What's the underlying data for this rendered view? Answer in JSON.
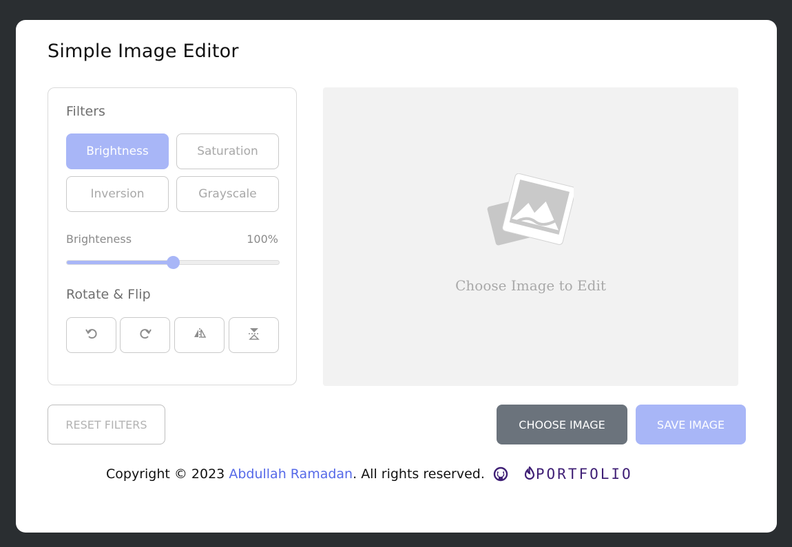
{
  "app": {
    "title": "Simple Image Editor"
  },
  "filters": {
    "heading": "Filters",
    "buttons": [
      {
        "label": "Brightness",
        "active": true
      },
      {
        "label": "Saturation",
        "active": false
      },
      {
        "label": "Inversion",
        "active": false
      },
      {
        "label": "Grayscale",
        "active": false
      }
    ]
  },
  "slider": {
    "label": "Brighteness",
    "value_text": "100%",
    "fill_fraction": 0.5
  },
  "rotate": {
    "heading": "Rotate & Flip",
    "buttons": [
      "rotate-left-icon",
      "rotate-right-icon",
      "flip-horizontal-icon",
      "flip-vertical-icon"
    ]
  },
  "preview": {
    "placeholder_text": "Choose Image to Edit",
    "icon": "image-placeholder-icon"
  },
  "actions": {
    "reset_label": "RESET FILTERS",
    "choose_label": "CHOOSE IMAGE",
    "save_label": "SAVE IMAGE"
  },
  "footer": {
    "prefix": "Copyright © 2023 ",
    "author": "Abdullah Ramadan",
    "suffix": ". All rights reserved.",
    "portfolio": "PORTFOLIO"
  },
  "colors": {
    "accent": "#a8b6f7",
    "choose_bg": "#6b737c",
    "link": "#5569e8",
    "portfolio": "#3f1f75",
    "page_bg": "#2a2e31"
  }
}
